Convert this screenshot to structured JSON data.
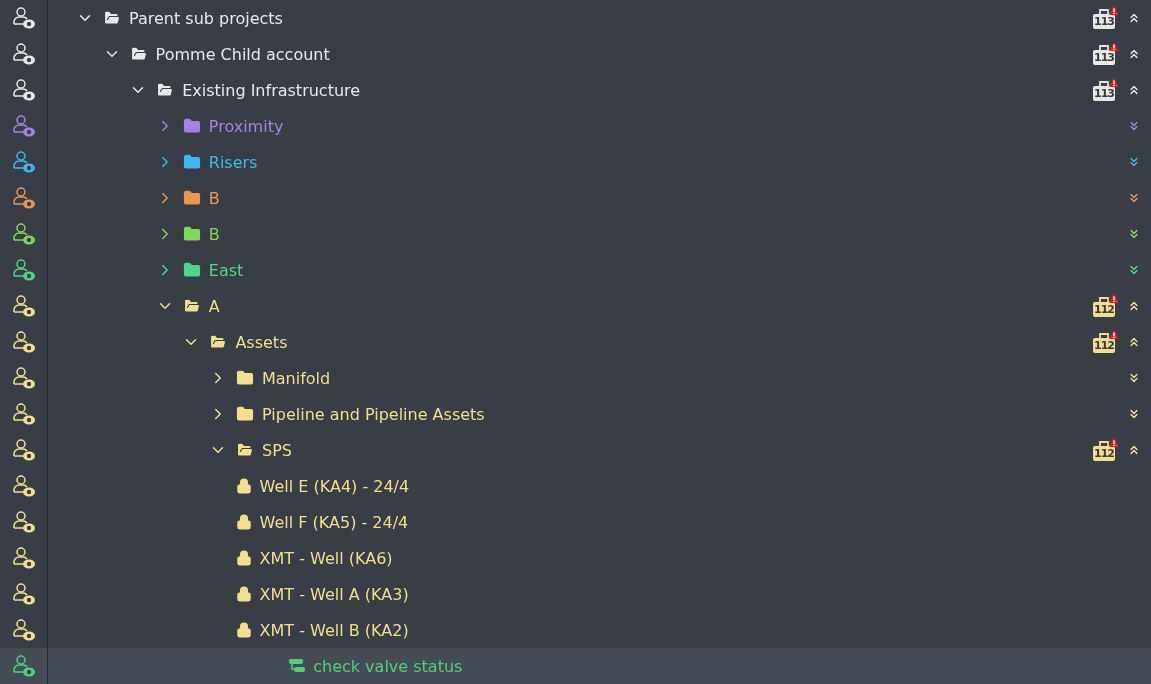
{
  "tree": [
    {
      "label": "Parent sub projects",
      "kind": "folder",
      "color": "#e8e8e8",
      "expanded": true,
      "selected": false,
      "badge": "113",
      "children": [
        {
          "label": "Pomme Child account",
          "kind": "folder",
          "color": "#e8e8e8",
          "expanded": true,
          "selected": false,
          "badge": "113",
          "children": [
            {
              "label": "Existing Infrastructure",
              "kind": "folder",
              "color": "#e8e8e8",
              "expanded": true,
              "selected": false,
              "badge": "113",
              "children": [
                {
                  "label": "Proximity",
                  "kind": "folder",
                  "color": "#a382e6",
                  "expanded": false,
                  "selected": false
                },
                {
                  "label": "Risers",
                  "kind": "folder",
                  "color": "#3db8ec",
                  "expanded": false,
                  "selected": false
                },
                {
                  "label": "B",
                  "kind": "folder",
                  "color": "#ec9550",
                  "expanded": false,
                  "selected": false
                },
                {
                  "label": "B",
                  "kind": "folder",
                  "color": "#7fd957",
                  "expanded": false,
                  "selected": false
                },
                {
                  "label": "East",
                  "kind": "folder",
                  "color": "#4fd68a",
                  "expanded": false,
                  "selected": false
                },
                {
                  "label": "A",
                  "kind": "folder",
                  "color": "#f2df8e",
                  "expanded": true,
                  "selected": false,
                  "badge": "112",
                  "children": [
                    {
                      "label": "Assets",
                      "kind": "folder",
                      "color": "#f2df8e",
                      "expanded": true,
                      "selected": false,
                      "badge": "112",
                      "children": [
                        {
                          "label": "Manifold",
                          "kind": "folder",
                          "color": "#f2df8e",
                          "expanded": false,
                          "selected": false
                        },
                        {
                          "label": "Pipeline and Pipeline Assets",
                          "kind": "folder",
                          "color": "#f2df8e",
                          "expanded": false,
                          "selected": false
                        },
                        {
                          "label": "SPS",
                          "kind": "folder",
                          "color": "#f2df8e",
                          "expanded": true,
                          "selected": false,
                          "badge": "112",
                          "children": [
                            {
                              "label": "Well E (KA4) - 24/4",
                              "kind": "locked",
                              "color": "#f2df8e",
                              "selected": false
                            },
                            {
                              "label": "Well F (KA5) - 24/4",
                              "kind": "locked",
                              "color": "#f2df8e",
                              "selected": false
                            },
                            {
                              "label": "XMT - Well (KA6)",
                              "kind": "locked",
                              "color": "#f2df8e",
                              "selected": false
                            },
                            {
                              "label": "XMT - Well A (KA3)",
                              "kind": "locked",
                              "color": "#f2df8e",
                              "selected": false
                            },
                            {
                              "label": "XMT - Well B (KA2)",
                              "kind": "locked",
                              "color": "#f2df8e",
                              "selected": false,
                              "children": [
                                {
                                  "label": "check valve status",
                                  "kind": "task",
                                  "color": "#4cd27a",
                                  "selected": true
                                }
                              ]
                            }
                          ]
                        }
                      ]
                    }
                  ]
                }
              ]
            }
          ]
        }
      ]
    }
  ]
}
